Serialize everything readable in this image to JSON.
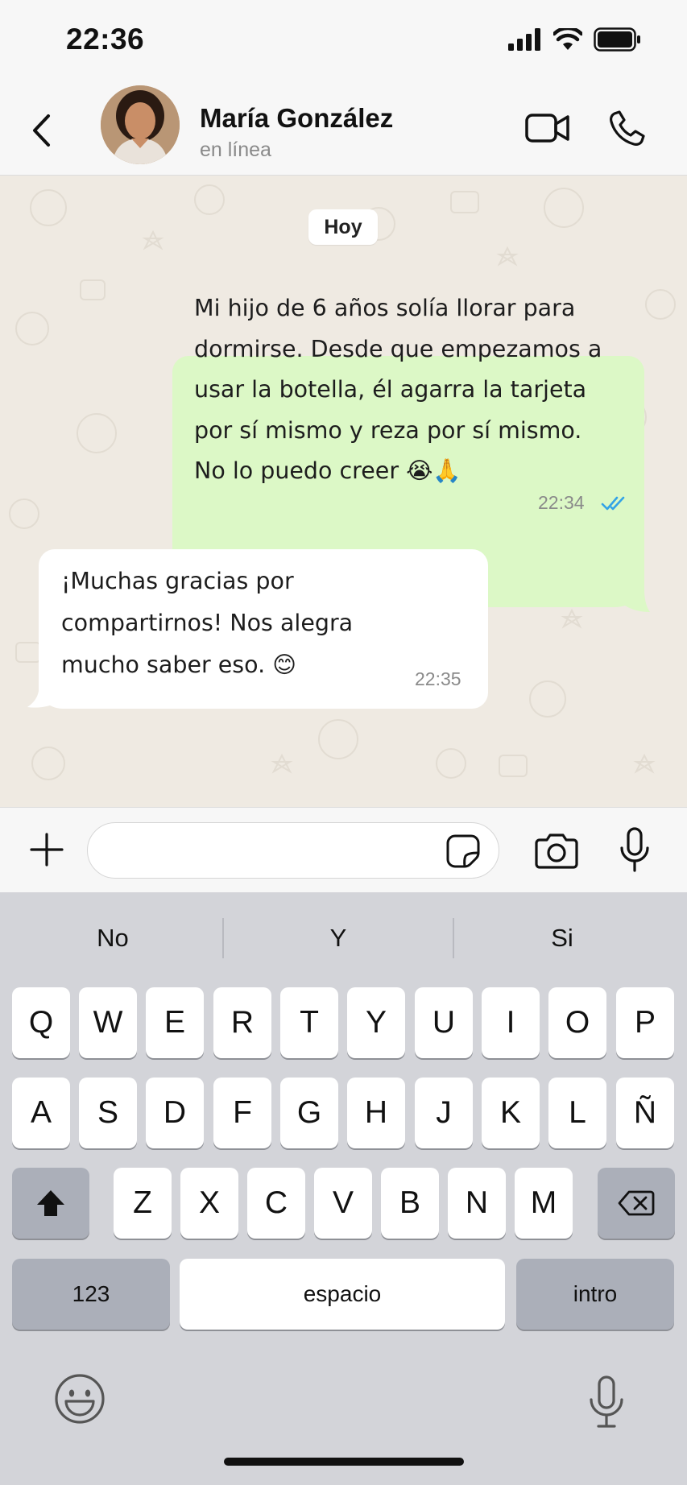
{
  "status_bar": {
    "time": "22:36",
    "signal_icon": "signal-bars-icon",
    "wifi_icon": "wifi-icon",
    "battery_icon": "battery-icon"
  },
  "header": {
    "contact_name": "María González",
    "contact_status": "en línea",
    "icons": {
      "back": "chevron-left-icon",
      "video": "video-camera-icon",
      "call": "phone-icon"
    }
  },
  "chat": {
    "date_label": "Hoy",
    "messages": [
      {
        "direction": "outgoing",
        "lines": [
          "Mi hijo de 6 años solía llorar para",
          "dormirse. Desde que empezamos a",
          "usar la botella, él agarra la tarjeta",
          "por sí mismo y reza por sí mismo.",
          "No lo puedo creer 😭🙏"
        ],
        "time": "22:34",
        "status": "read",
        "bubble_color": "#dcf8c6"
      },
      {
        "direction": "incoming",
        "lines": [
          "¡Muchas gracias por",
          "compartirnos! Nos alegra",
          "mucho saber eso. 😊"
        ],
        "time": "22:35",
        "bubble_color": "#ffffff"
      }
    ]
  },
  "input_bar": {
    "placeholder": "",
    "icons": {
      "add": "plus-icon",
      "sticker": "sticker-icon",
      "camera": "camera-icon",
      "mic": "microphone-icon"
    }
  },
  "keyboard": {
    "suggestions": [
      "No",
      "Y",
      "Si"
    ],
    "row1": [
      "Q",
      "W",
      "E",
      "R",
      "T",
      "Y",
      "U",
      "I",
      "O",
      "P"
    ],
    "row2": [
      "A",
      "S",
      "D",
      "F",
      "G",
      "H",
      "J",
      "K",
      "L",
      "Ñ"
    ],
    "row3": [
      "Z",
      "X",
      "C",
      "V",
      "B",
      "N",
      "M"
    ],
    "numbers_label": "123",
    "space_label": "espacio",
    "return_label": "intro",
    "icons": {
      "shift": "shift-icon",
      "backspace": "backspace-icon",
      "emoji": "emoji-icon",
      "dictation": "microphone-icon"
    }
  },
  "colors": {
    "chat_background": "#efeae2",
    "read_check": "#34a3e6",
    "keyboard_background": "#d3d4d9"
  }
}
